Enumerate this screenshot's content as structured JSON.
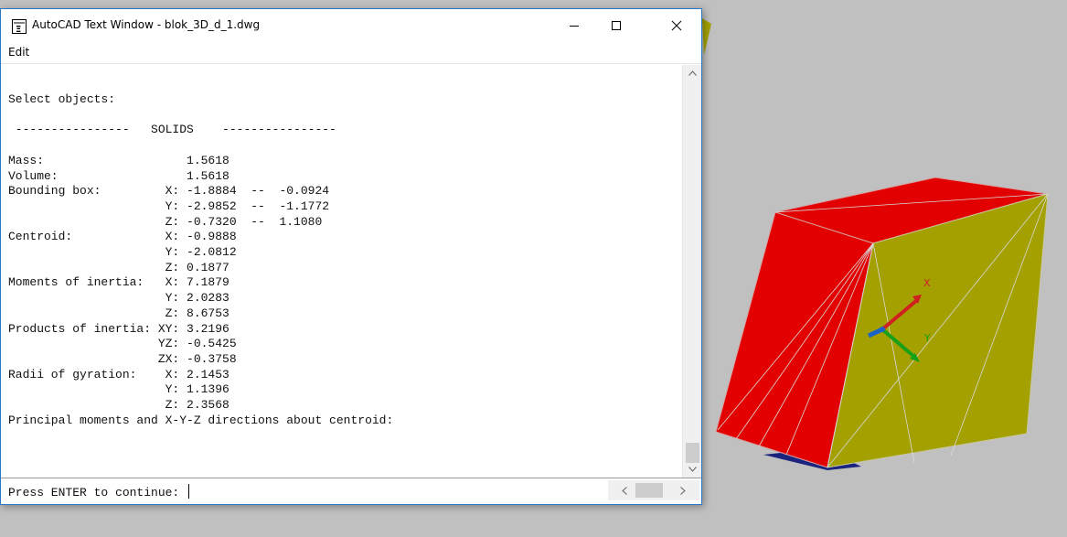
{
  "window": {
    "title": "AutoCAD Text Window - blok_3D_d_1.dwg",
    "menu": {
      "edit": "Edit"
    }
  },
  "output_lines": [
    "Select objects:",
    "",
    " ----------------   SOLIDS    ----------------",
    "",
    "Mass:                    1.5618",
    "Volume:                  1.5618",
    "Bounding box:         X: -1.8884  --  -0.0924",
    "                      Y: -2.9852  --  -1.1772",
    "                      Z: -0.7320  --  1.1080",
    "Centroid:             X: -0.9888",
    "                      Y: -2.0812",
    "                      Z: 0.1877",
    "Moments of inertia:   X: 7.1879",
    "                      Y: 2.0283",
    "                      Z: 8.6753",
    "Products of inertia: XY: 3.2196",
    "                     YZ: -0.5425",
    "                     ZX: -0.3758",
    "Radii of gyration:    X: 2.1453",
    "                      Y: 1.1396",
    "                      Z: 2.3568",
    "Principal moments and X-Y-Z directions about centroid:"
  ],
  "command_line": {
    "prompt": "Press ENTER to continue: "
  },
  "viewport": {
    "background_color": "#c0c0c0",
    "solid_colors": {
      "red": "#e20000",
      "olive": "#a3a000",
      "dark": "#1a237e"
    },
    "ucs_axis_labels": {
      "x": "X",
      "y": "Y"
    }
  },
  "icons": {
    "minimize": "minimize-icon",
    "maximize": "maximize-icon",
    "close": "close-icon",
    "scroll_up": "chevron-up-icon",
    "scroll_down": "chevron-down-icon",
    "scroll_left": "chevron-left-icon",
    "scroll_right": "chevron-right-icon"
  }
}
